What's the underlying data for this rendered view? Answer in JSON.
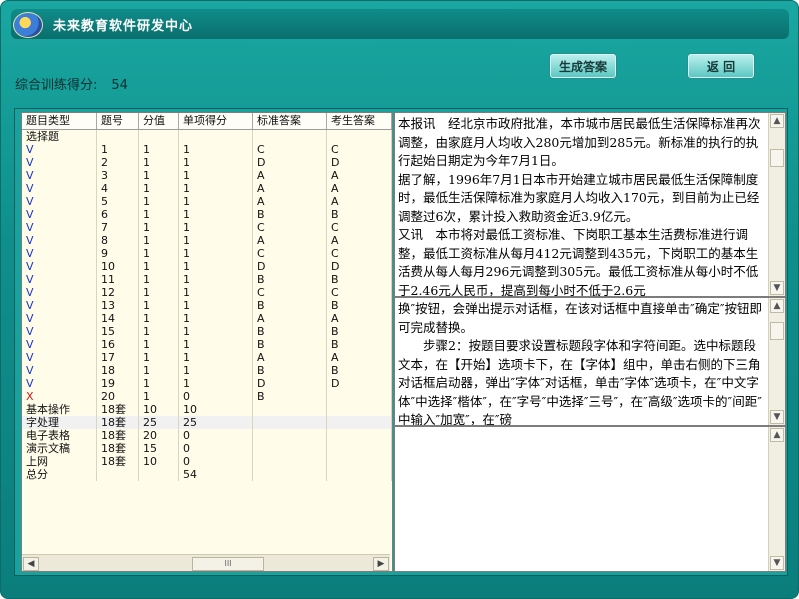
{
  "app": {
    "title": "未来教育软件研发中心"
  },
  "summary": {
    "label": "综合训练得分:",
    "score": "54"
  },
  "buttons": {
    "generate": "生成答案",
    "back": "返  回"
  },
  "table": {
    "headers": [
      "题目类型",
      "题号",
      "分值",
      "单项得分",
      "标准答案",
      "考生答案"
    ],
    "section": "选择题",
    "rows": [
      [
        "V",
        "1",
        "1",
        "1",
        "C",
        "C"
      ],
      [
        "V",
        "2",
        "1",
        "1",
        "D",
        "D"
      ],
      [
        "V",
        "3",
        "1",
        "1",
        "A",
        "A"
      ],
      [
        "V",
        "4",
        "1",
        "1",
        "A",
        "A"
      ],
      [
        "V",
        "5",
        "1",
        "1",
        "A",
        "A"
      ],
      [
        "V",
        "6",
        "1",
        "1",
        "B",
        "B"
      ],
      [
        "V",
        "7",
        "1",
        "1",
        "C",
        "C"
      ],
      [
        "V",
        "8",
        "1",
        "1",
        "A",
        "A"
      ],
      [
        "V",
        "9",
        "1",
        "1",
        "C",
        "C"
      ],
      [
        "V",
        "10",
        "1",
        "1",
        "D",
        "D"
      ],
      [
        "V",
        "11",
        "1",
        "1",
        "B",
        "B"
      ],
      [
        "V",
        "12",
        "1",
        "1",
        "C",
        "C"
      ],
      [
        "V",
        "13",
        "1",
        "1",
        "B",
        "B"
      ],
      [
        "V",
        "14",
        "1",
        "1",
        "A",
        "A"
      ],
      [
        "V",
        "15",
        "1",
        "1",
        "B",
        "B"
      ],
      [
        "V",
        "16",
        "1",
        "1",
        "B",
        "B"
      ],
      [
        "V",
        "17",
        "1",
        "1",
        "A",
        "A"
      ],
      [
        "V",
        "18",
        "1",
        "1",
        "B",
        "B"
      ],
      [
        "V",
        "19",
        "1",
        "1",
        "D",
        "D"
      ],
      [
        "X",
        "20",
        "1",
        "0",
        "B",
        ""
      ]
    ],
    "summary_rows": [
      [
        "基本操作",
        "18套",
        "10",
        "10",
        "",
        ""
      ],
      [
        "字处理",
        "18套",
        "25",
        "25",
        "",
        ""
      ],
      [
        "电子表格",
        "18套",
        "20",
        "0",
        "",
        ""
      ],
      [
        "演示文稿",
        "18套",
        "15",
        "0",
        "",
        ""
      ],
      [
        "上网",
        "18套",
        "10",
        "0",
        "",
        ""
      ],
      [
        "总分",
        "",
        "",
        "54",
        "",
        ""
      ]
    ],
    "scroll_thumb": "III"
  },
  "question_text": "本报讯　经北京市政府批准，本市城市居民最低生活保障标准再次调整，由家庭月人均收入280元增加到285元。新标准的执行的执行起始日期定为今年7月1日。\n据了解，1996年7月1日本市开始建立城市居民最低生活保障制度时，最低生活保障标准为家庭月人均收入170元，到目前为止已经调整过6次，累计投入救助资金近3.9亿元。\n又讯　本市将对最低工资标准、下岗职工基本生活费标准进行调整，最低工资标准从每月412元调整到435元，下岗职工的基本生活费从每人每月296元调整到305元。最低工资标准从每小时不低于2.46元人民币，提高到每小时不低于2.6元",
  "answer_text": "换″按钮，会弹出提示对话框，在该对话框中直接单击″确定″按钮即可完成替换。\n　　步骤2：按题目要求设置标题段字体和字符间距。选中标题段文本，在【开始】选项卡下，在【字体】组中，单击右侧的下三角对话框启动器，弹出″字体″对话框，单击″字体″选项卡，在″中文字体″中选择″楷体″，在″字号″中选择″三号″，在″高级″选项卡的″间距″中输入″加宽″，在″磅",
  "colors": {
    "window": "#0f8f8c",
    "grid": "#fffdea",
    "correct": "#1a35c9",
    "wrong": "#d11919"
  }
}
